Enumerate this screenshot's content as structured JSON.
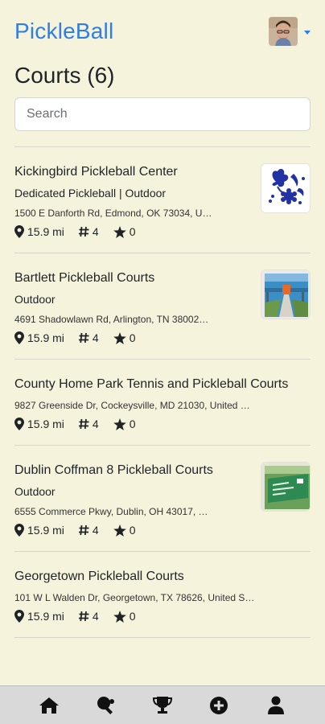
{
  "header": {
    "brand": "PickleBall",
    "profile_icon": "avatar",
    "caret_icon": "chevron-down-icon",
    "accent_color": "#2f7ee6"
  },
  "page": {
    "title": "Courts (6)"
  },
  "search": {
    "placeholder": "Search",
    "value": ""
  },
  "courts": [
    {
      "name": "Kickingbird Pickleball Center",
      "type": "Dedicated Pickleball | Outdoor",
      "address": "1500 E Danforth Rd, Edmond, OK 73034, U…",
      "distance": "15.9 mi",
      "courts": "4",
      "rating": "0",
      "thumbnail": "floral-logo"
    },
    {
      "name": "Bartlett Pickleball Courts",
      "type": "Outdoor",
      "address": "4691 Shadowlawn Rd, Arlington, TN 38002…",
      "distance": "15.9 mi",
      "courts": "4",
      "rating": "0",
      "thumbnail": "court-photo"
    },
    {
      "name": "County Home Park Tennis and Pickleball Courts",
      "type": "",
      "address": "9827 Greenside Dr, Cockeysville, MD 21030, United …",
      "distance": "15.9 mi",
      "courts": "4",
      "rating": "0",
      "thumbnail": ""
    },
    {
      "name": "Dublin Coffman 8 Pickleball Courts",
      "type": "Outdoor",
      "address": "6555 Commerce Pkwy, Dublin, OH 43017, …",
      "distance": "15.9 mi",
      "courts": "4",
      "rating": "0",
      "thumbnail": "sign-photo"
    },
    {
      "name": "Georgetown Pickleball Courts",
      "type": "",
      "address": "101 W L Walden Dr, Georgetown, TX 78626, United S…",
      "distance": "15.9 mi",
      "courts": "4",
      "rating": "0",
      "thumbnail": ""
    }
  ],
  "bottom_nav": [
    {
      "icon": "home-icon"
    },
    {
      "icon": "paddle-icon"
    },
    {
      "icon": "trophy-icon"
    },
    {
      "icon": "add-circle-icon"
    },
    {
      "icon": "user-icon"
    }
  ]
}
